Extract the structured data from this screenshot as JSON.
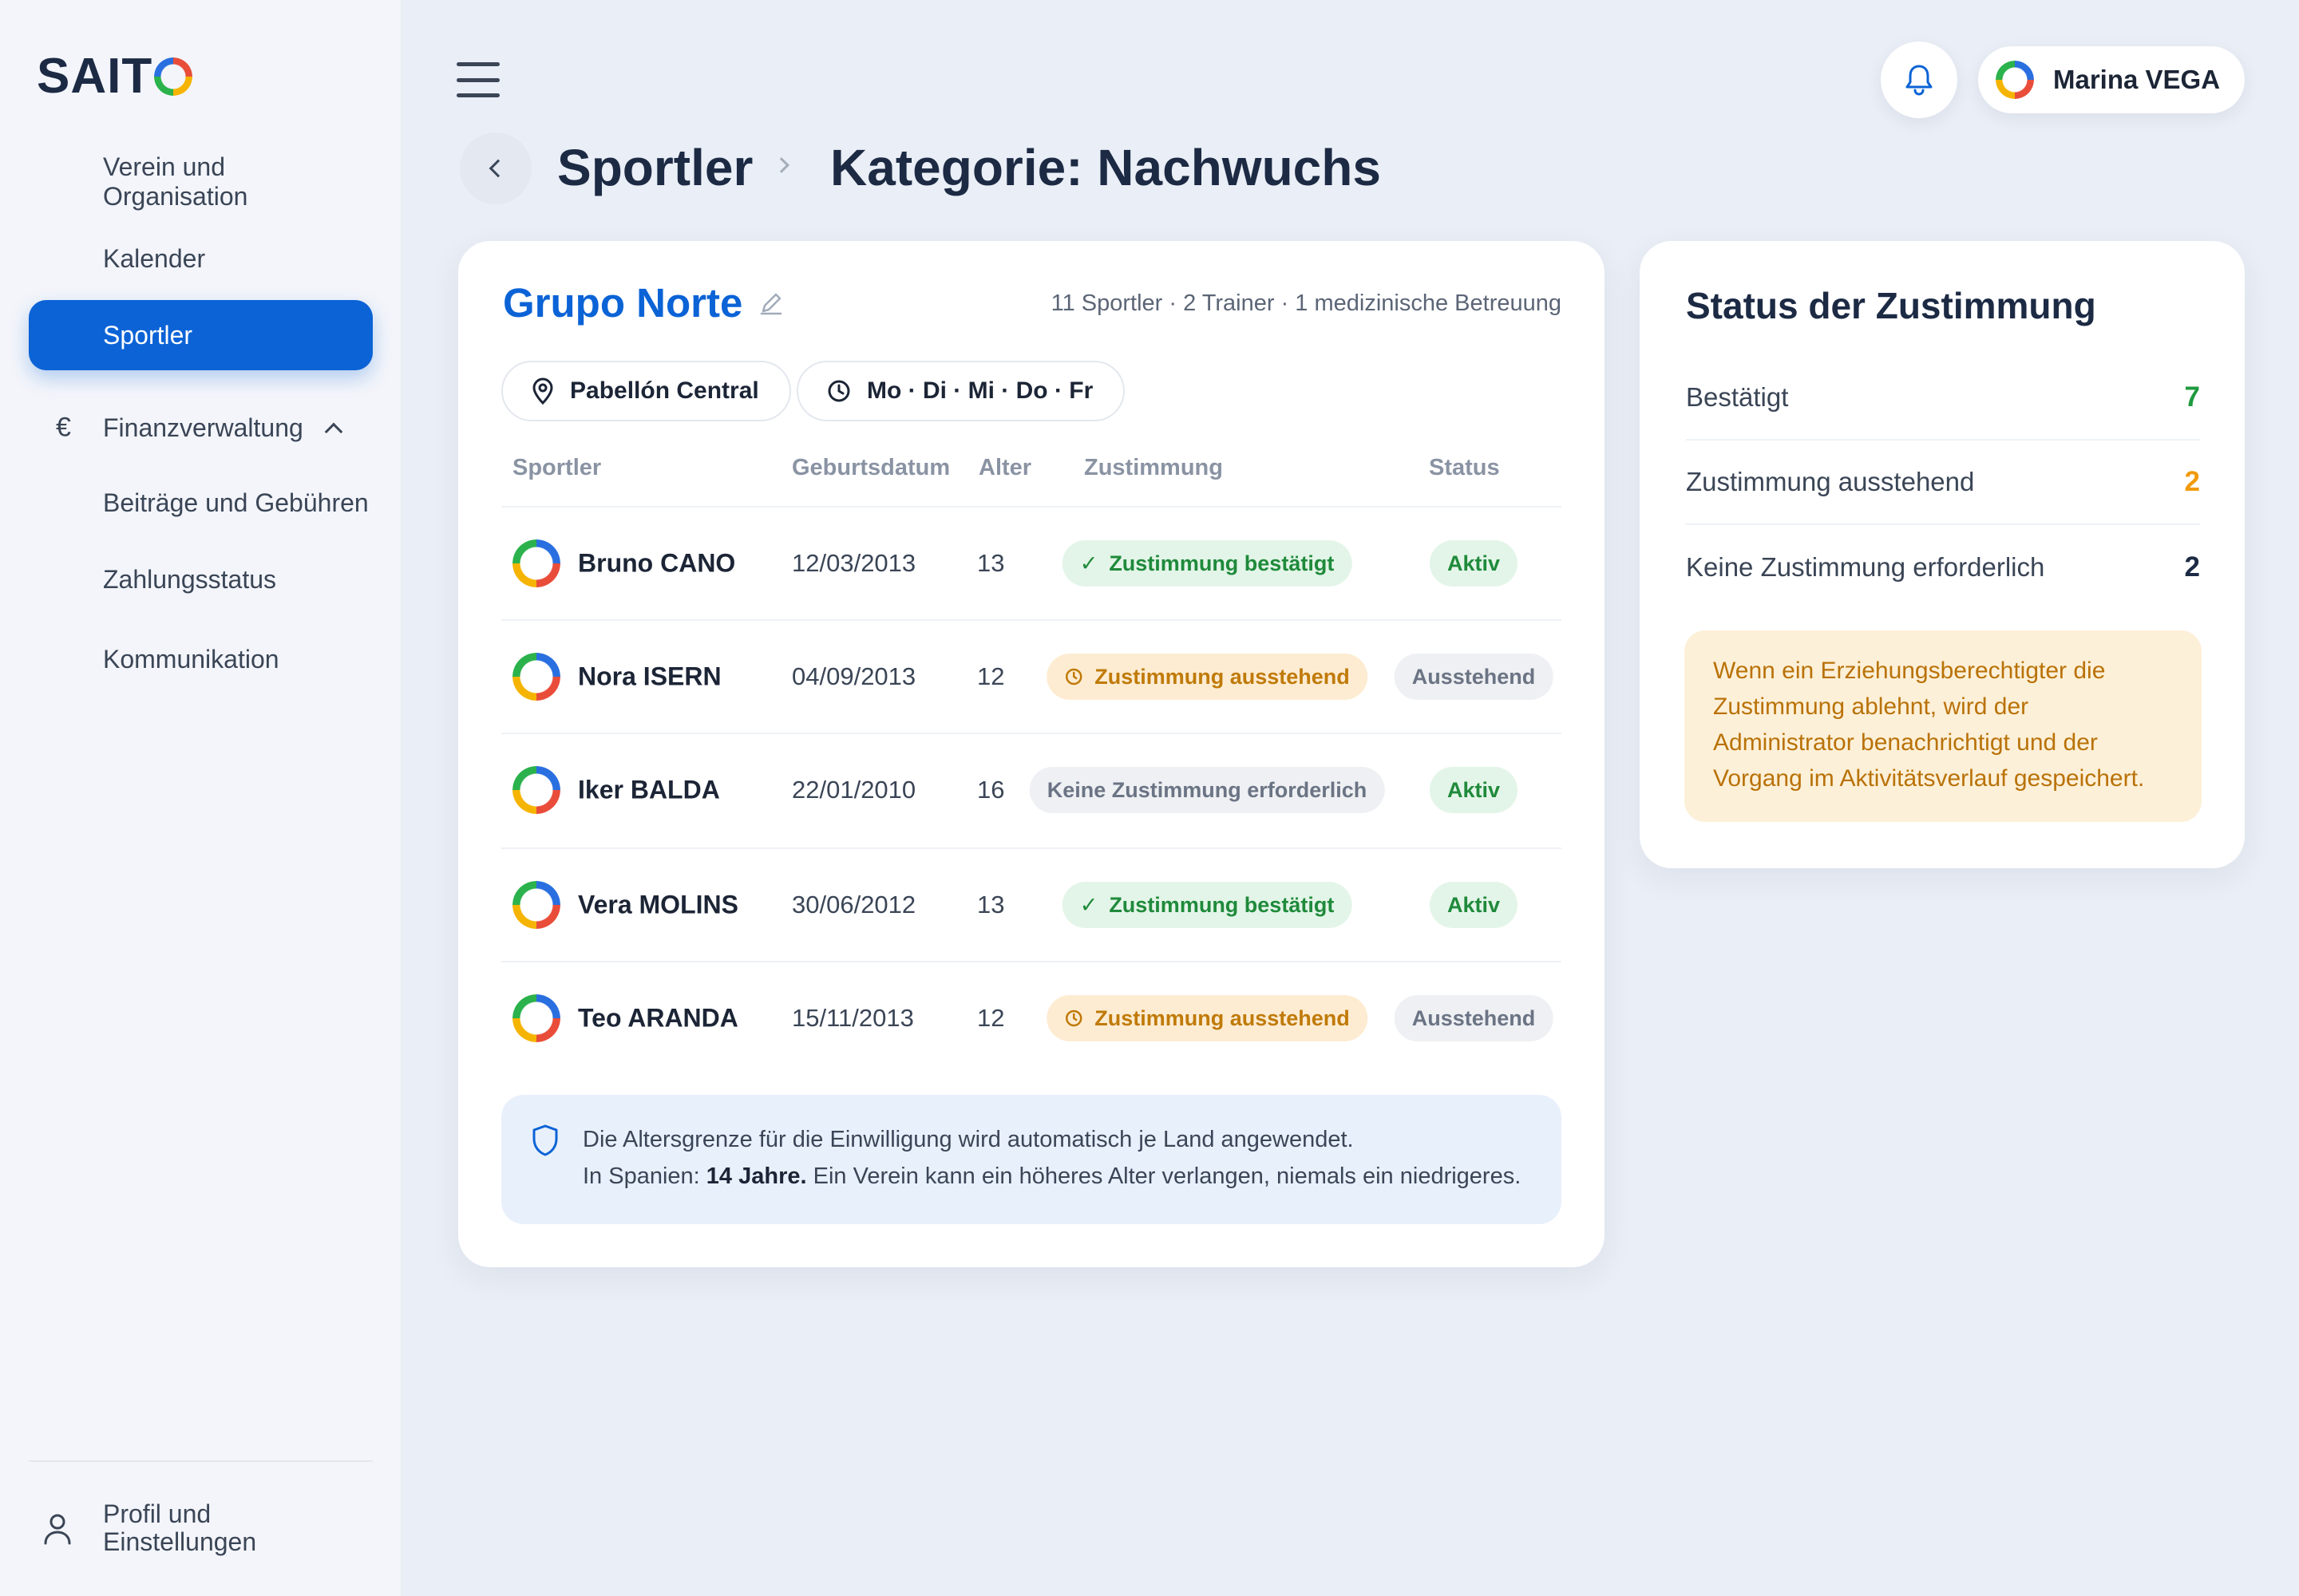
{
  "app": {
    "logo": "SAIT"
  },
  "sidebar": {
    "items": [
      {
        "label": "Verein und Organisation"
      },
      {
        "label": "Kalender"
      },
      {
        "label": "Sportler"
      },
      {
        "label": "Finanzverwaltung"
      },
      {
        "label": "Beiträge und Gebühren"
      },
      {
        "label": "Zahlungsstatus"
      },
      {
        "label": "Kommunikation"
      }
    ],
    "finance_icon": "€",
    "profile": {
      "line1": "Profil und",
      "line2": "Einstellungen"
    }
  },
  "topbar": {
    "user_name": "Marina VEGA"
  },
  "breadcrumb": {
    "section": "Sportler",
    "current": "Kategorie: Nachwuchs"
  },
  "group": {
    "title": "Grupo Norte",
    "meta": "11 Sportler · 2 Trainer · 1 medizinische Betreuung",
    "location": "Pabellón Central",
    "schedule": "Mo · Di · Mi · Do · Fr"
  },
  "table": {
    "headers": [
      "Sportler",
      "Geburtsdatum",
      "Alter",
      "Zustimmung",
      "Status"
    ],
    "rows": [
      {
        "name": "Bruno CANO",
        "dob": "12/03/2013",
        "age": "13",
        "consent": "Zustimmung bestätigt",
        "status": "Aktiv"
      },
      {
        "name": "Nora ISERN",
        "dob": "04/09/2013",
        "age": "12",
        "consent": "Zustimmung ausstehend",
        "status": "Ausstehend"
      },
      {
        "name": "Iker BALDA",
        "dob": "22/01/2010",
        "age": "16",
        "consent": "Keine Zustimmung erforderlich",
        "status": "Aktiv"
      },
      {
        "name": "Vera MOLINS",
        "dob": "30/06/2012",
        "age": "13",
        "consent": "Zustimmung bestätigt",
        "status": "Aktiv"
      },
      {
        "name": "Teo ARANDA",
        "dob": "15/11/2013",
        "age": "12",
        "consent": "Zustimmung ausstehend",
        "status": "Ausstehend"
      }
    ]
  },
  "info": {
    "line1": "Die Altersgrenze für die Einwilligung wird automatisch je Land angewendet.",
    "line2_prefix": "In Spanien: ",
    "line2_bold": "14 Jahre.",
    "line2_suffix": " Ein Verein kann ein höheres Alter verlangen, niemals ein niedrigeres."
  },
  "consent_status": {
    "title": "Status der Zustimmung",
    "stats": [
      {
        "label": "Bestätigt",
        "value": "7",
        "color": "#1f9a3e"
      },
      {
        "label": "Zustimmung ausstehend",
        "value": "2",
        "color": "#f19a0b"
      },
      {
        "label": "Keine Zustimmung erforderlich",
        "value": "2",
        "color": "#1c2a44"
      }
    ],
    "note": "Wenn ein Erziehungsberechtigter die Zustimmung ablehnt, wird der Administrator benachrichtigt und der Vorgang im Aktivitätsverlauf gespeichert."
  },
  "colors": {
    "accent": "#0b63d6",
    "success": "#1f8a3b",
    "warning": "#c07a08"
  },
  "icons": {
    "back": "chevron-left-icon",
    "bell": "bell-icon",
    "location": "map-pin-icon",
    "time": "clock-icon",
    "shield": "shield-icon",
    "profile": "user-icon"
  }
}
